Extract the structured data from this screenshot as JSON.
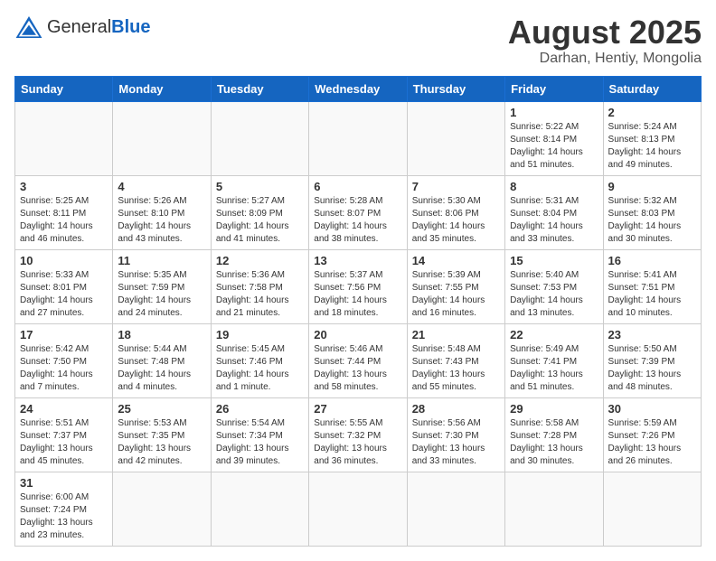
{
  "header": {
    "logo_general": "General",
    "logo_blue": "Blue",
    "title": "August 2025",
    "subtitle": "Darhan, Hentiy, Mongolia"
  },
  "days_of_week": [
    "Sunday",
    "Monday",
    "Tuesday",
    "Wednesday",
    "Thursday",
    "Friday",
    "Saturday"
  ],
  "weeks": [
    [
      {
        "day": "",
        "info": ""
      },
      {
        "day": "",
        "info": ""
      },
      {
        "day": "",
        "info": ""
      },
      {
        "day": "",
        "info": ""
      },
      {
        "day": "",
        "info": ""
      },
      {
        "day": "1",
        "info": "Sunrise: 5:22 AM\nSunset: 8:14 PM\nDaylight: 14 hours and 51 minutes."
      },
      {
        "day": "2",
        "info": "Sunrise: 5:24 AM\nSunset: 8:13 PM\nDaylight: 14 hours and 49 minutes."
      }
    ],
    [
      {
        "day": "3",
        "info": "Sunrise: 5:25 AM\nSunset: 8:11 PM\nDaylight: 14 hours and 46 minutes."
      },
      {
        "day": "4",
        "info": "Sunrise: 5:26 AM\nSunset: 8:10 PM\nDaylight: 14 hours and 43 minutes."
      },
      {
        "day": "5",
        "info": "Sunrise: 5:27 AM\nSunset: 8:09 PM\nDaylight: 14 hours and 41 minutes."
      },
      {
        "day": "6",
        "info": "Sunrise: 5:28 AM\nSunset: 8:07 PM\nDaylight: 14 hours and 38 minutes."
      },
      {
        "day": "7",
        "info": "Sunrise: 5:30 AM\nSunset: 8:06 PM\nDaylight: 14 hours and 35 minutes."
      },
      {
        "day": "8",
        "info": "Sunrise: 5:31 AM\nSunset: 8:04 PM\nDaylight: 14 hours and 33 minutes."
      },
      {
        "day": "9",
        "info": "Sunrise: 5:32 AM\nSunset: 8:03 PM\nDaylight: 14 hours and 30 minutes."
      }
    ],
    [
      {
        "day": "10",
        "info": "Sunrise: 5:33 AM\nSunset: 8:01 PM\nDaylight: 14 hours and 27 minutes."
      },
      {
        "day": "11",
        "info": "Sunrise: 5:35 AM\nSunset: 7:59 PM\nDaylight: 14 hours and 24 minutes."
      },
      {
        "day": "12",
        "info": "Sunrise: 5:36 AM\nSunset: 7:58 PM\nDaylight: 14 hours and 21 minutes."
      },
      {
        "day": "13",
        "info": "Sunrise: 5:37 AM\nSunset: 7:56 PM\nDaylight: 14 hours and 18 minutes."
      },
      {
        "day": "14",
        "info": "Sunrise: 5:39 AM\nSunset: 7:55 PM\nDaylight: 14 hours and 16 minutes."
      },
      {
        "day": "15",
        "info": "Sunrise: 5:40 AM\nSunset: 7:53 PM\nDaylight: 14 hours and 13 minutes."
      },
      {
        "day": "16",
        "info": "Sunrise: 5:41 AM\nSunset: 7:51 PM\nDaylight: 14 hours and 10 minutes."
      }
    ],
    [
      {
        "day": "17",
        "info": "Sunrise: 5:42 AM\nSunset: 7:50 PM\nDaylight: 14 hours and 7 minutes."
      },
      {
        "day": "18",
        "info": "Sunrise: 5:44 AM\nSunset: 7:48 PM\nDaylight: 14 hours and 4 minutes."
      },
      {
        "day": "19",
        "info": "Sunrise: 5:45 AM\nSunset: 7:46 PM\nDaylight: 14 hours and 1 minute."
      },
      {
        "day": "20",
        "info": "Sunrise: 5:46 AM\nSunset: 7:44 PM\nDaylight: 13 hours and 58 minutes."
      },
      {
        "day": "21",
        "info": "Sunrise: 5:48 AM\nSunset: 7:43 PM\nDaylight: 13 hours and 55 minutes."
      },
      {
        "day": "22",
        "info": "Sunrise: 5:49 AM\nSunset: 7:41 PM\nDaylight: 13 hours and 51 minutes."
      },
      {
        "day": "23",
        "info": "Sunrise: 5:50 AM\nSunset: 7:39 PM\nDaylight: 13 hours and 48 minutes."
      }
    ],
    [
      {
        "day": "24",
        "info": "Sunrise: 5:51 AM\nSunset: 7:37 PM\nDaylight: 13 hours and 45 minutes."
      },
      {
        "day": "25",
        "info": "Sunrise: 5:53 AM\nSunset: 7:35 PM\nDaylight: 13 hours and 42 minutes."
      },
      {
        "day": "26",
        "info": "Sunrise: 5:54 AM\nSunset: 7:34 PM\nDaylight: 13 hours and 39 minutes."
      },
      {
        "day": "27",
        "info": "Sunrise: 5:55 AM\nSunset: 7:32 PM\nDaylight: 13 hours and 36 minutes."
      },
      {
        "day": "28",
        "info": "Sunrise: 5:56 AM\nSunset: 7:30 PM\nDaylight: 13 hours and 33 minutes."
      },
      {
        "day": "29",
        "info": "Sunrise: 5:58 AM\nSunset: 7:28 PM\nDaylight: 13 hours and 30 minutes."
      },
      {
        "day": "30",
        "info": "Sunrise: 5:59 AM\nSunset: 7:26 PM\nDaylight: 13 hours and 26 minutes."
      }
    ],
    [
      {
        "day": "31",
        "info": "Sunrise: 6:00 AM\nSunset: 7:24 PM\nDaylight: 13 hours and 23 minutes."
      },
      {
        "day": "",
        "info": ""
      },
      {
        "day": "",
        "info": ""
      },
      {
        "day": "",
        "info": ""
      },
      {
        "day": "",
        "info": ""
      },
      {
        "day": "",
        "info": ""
      },
      {
        "day": "",
        "info": ""
      }
    ]
  ]
}
